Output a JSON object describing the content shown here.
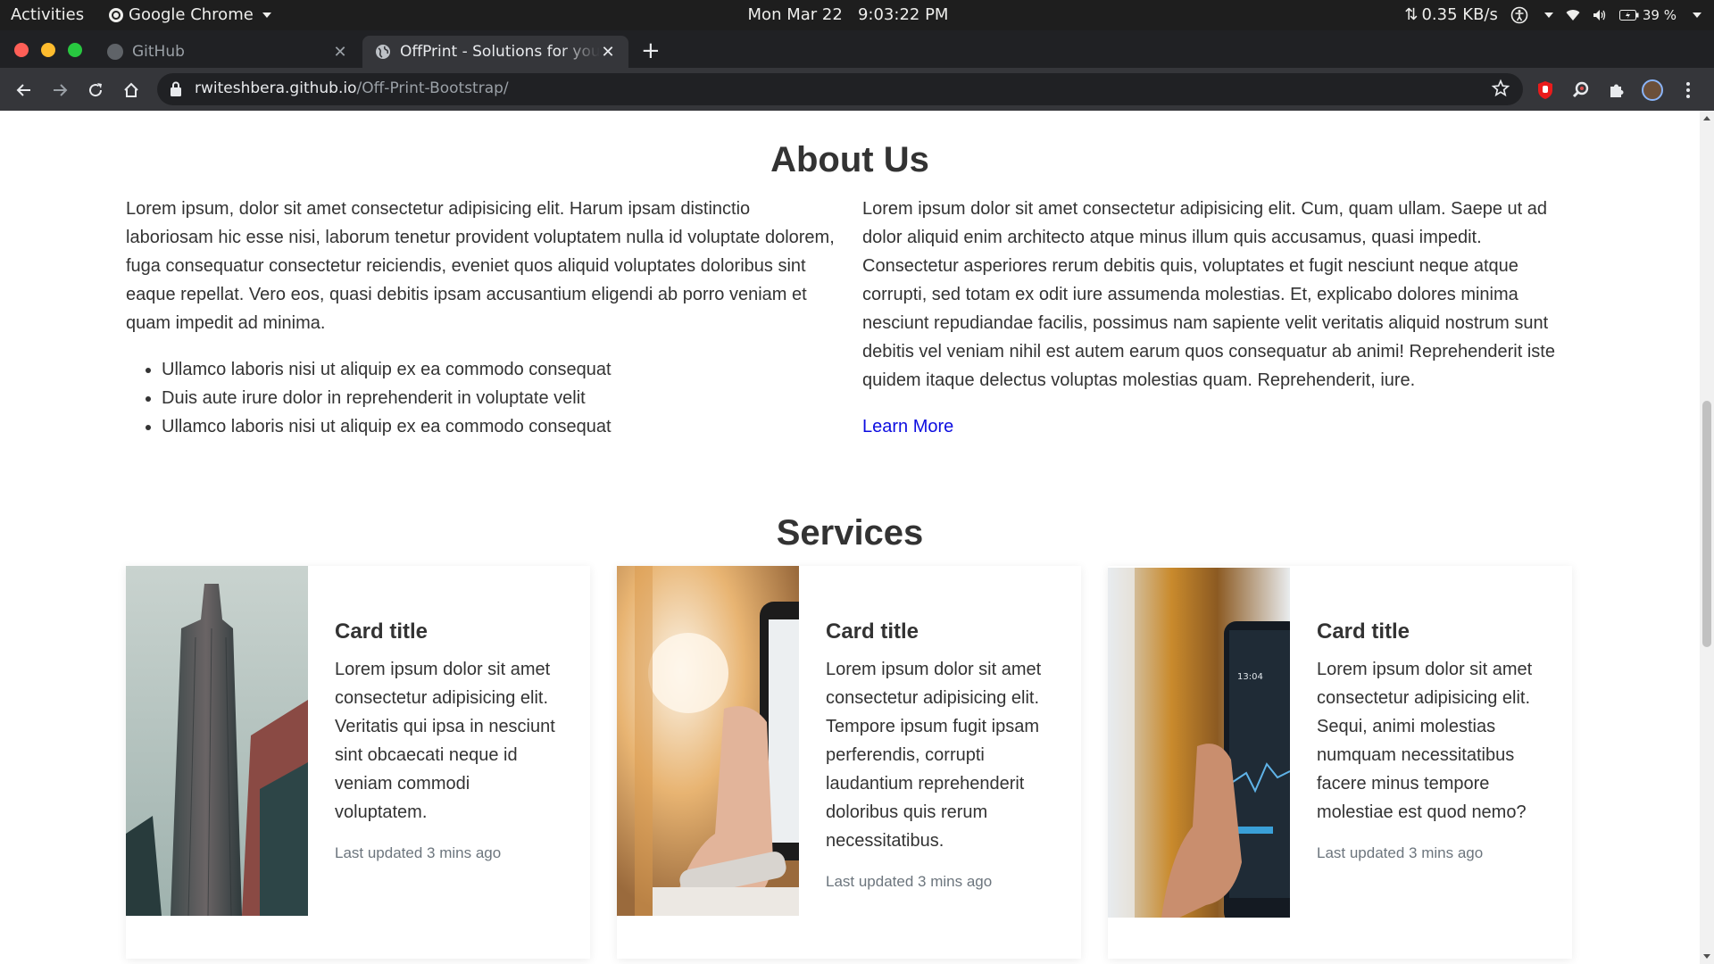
{
  "topbar": {
    "activities": "Activities",
    "app_name": "Google Chrome",
    "clock": "Mon Mar 22   9:03:22 PM",
    "net_speed": "0.35 KB/s",
    "battery": "39 %"
  },
  "browser": {
    "tabs": [
      {
        "title": "GitHub",
        "icon": "github-icon"
      },
      {
        "title": "OffPrint - Solutions for your",
        "icon": "globe-icon"
      }
    ],
    "url_host": "rwiteshbera.github.io",
    "url_path": "/Off-Print-Bootstrap/"
  },
  "about": {
    "heading": "About Us",
    "left_paragraph": "Lorem ipsum, dolor sit amet consectetur adipisicing elit. Harum ipsam distinctio laboriosam hic esse nisi, laborum tenetur provident voluptatem nulla id voluptate dolorem, fuga consequatur consectetur reiciendis, eveniet quos aliquid voluptates doloribus sint eaque repellat. Vero eos, quasi debitis ipsam accusantium eligendi ab porro veniam et quam impedit ad minima.",
    "bullets": [
      "Ullamco laboris nisi ut aliquip ex ea commodo consequat",
      "Duis aute irure dolor in reprehenderit in voluptate velit",
      "Ullamco laboris nisi ut aliquip ex ea commodo consequat"
    ],
    "right_paragraph": "Lorem ipsum dolor sit amet consectetur adipisicing elit. Cum, quam ullam. Saepe ut ad dolor aliquid enim architecto atque minus illum quis accusamus, quasi impedit. Consectetur asperiores rerum debitis quis, voluptates et fugit nesciunt neque atque corrupti, sed totam ex odit iure assumenda molestias. Et, explicabo dolores minima nesciunt repudiandae facilis, possimus nam sapiente velit veritatis aliquid nostrum sunt debitis vel veniam nihil est autem earum quos consequatur ab animi! Reprehenderit iste quidem itaque delectus voluptas molestias quam. Reprehenderit, iure.",
    "link": "Learn More"
  },
  "services": {
    "heading": "Services",
    "cards": [
      {
        "title": "Card title",
        "text": "Lorem ipsum dolor sit amet consectetur adipisicing elit. Veritatis qui ipsa in nesciunt sint obcaecati neque id veniam commodi voluptatem.",
        "meta": "Last updated 3 mins ago"
      },
      {
        "title": "Card title",
        "text": "Lorem ipsum dolor sit amet consectetur adipisicing elit. Tempore ipsum fugit ipsam perferendis, corrupti laudantium reprehenderit doloribus quis rerum necessitatibus.",
        "meta": "Last updated 3 mins ago"
      },
      {
        "title": "Card title",
        "text": "Lorem ipsum dolor sit amet consectetur adipisicing elit. Sequi, animi molestias numquam necessitatibus facere minus tempore molestiae est quod nemo?",
        "meta": "Last updated 3 mins ago"
      }
    ]
  },
  "colors": {
    "link": "#0d0de0",
    "traffic_close": "#ff5f57",
    "traffic_min": "#febc2e",
    "traffic_max": "#28c840"
  }
}
